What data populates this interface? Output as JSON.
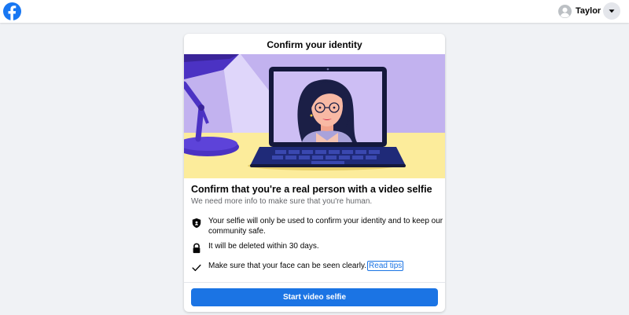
{
  "topbar": {
    "logo_icon": "facebook-logo-icon",
    "profile_name": "Taylor",
    "avatar_icon": "default-avatar-icon",
    "menu_icon": "caret-down-icon"
  },
  "card": {
    "title": "Confirm your identity",
    "heading": "Confirm that you're a real person with a video selfie",
    "subtext": "We need more info to make sure that you're human.",
    "items": [
      {
        "icon": "shield-icon",
        "text": "Your selfie will only be used to confirm your identity and to keep our community safe."
      },
      {
        "icon": "lock-icon",
        "text": "It will be deleted within 30 days."
      },
      {
        "icon": "checkmark-icon",
        "text": "Make sure that your face can be seen clearly.",
        "link": "Read tips"
      }
    ],
    "button_label": "Start video selfie"
  },
  "colors": {
    "brand_blue": "#1b74e4",
    "page_bg": "#f0f2f5",
    "illustration_purple": "#c5b6f0",
    "illustration_yellow": "#fbeb9a"
  }
}
